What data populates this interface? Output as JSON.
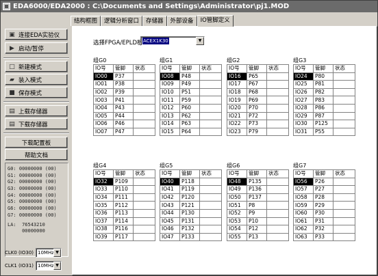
{
  "window": {
    "title": "EDA6000/EDA2000 : C:\\Documents and Settings\\Administrator\\pj1.MOD"
  },
  "sidebar": {
    "buttons": [
      {
        "label": "连接EDA实验仪",
        "icon": "connect-icon"
      },
      {
        "label": "启动/暂停",
        "icon": "play-icon"
      },
      {
        "label": "新建模式",
        "icon": "new-file-icon"
      },
      {
        "label": "装入模式",
        "icon": "open-folder-icon"
      },
      {
        "label": "保存模式",
        "icon": "save-disk-icon"
      },
      {
        "label": "上载存储器",
        "icon": "upload-memory-icon"
      },
      {
        "label": "下载存储器",
        "icon": "download-memory-icon"
      },
      {
        "label": "下载配置板"
      },
      {
        "label": "帮助文档"
      }
    ],
    "registers": [
      "G0: 00000000 (00)",
      "G1: 00000000 (00)",
      "G2: 00000000 (00)",
      "G3: 00000000 (00)",
      "G4: 00000000 (00)",
      "G5: 00000000 (00)",
      "G6: 00000000 (00)",
      "G7: 00000000 (00)"
    ],
    "la_line1": "LA:  76543210",
    "la_line2": "     00000000",
    "clk0": {
      "label": "CLK0 (IO30)",
      "value": "10MHz"
    },
    "clk1": {
      "label": "CLK1 (IO31)",
      "value": "10MHz"
    }
  },
  "tabs": [
    {
      "label": "结构框图",
      "active": false
    },
    {
      "label": "逻辑分析窗口",
      "active": false
    },
    {
      "label": "存储器",
      "active": false
    },
    {
      "label": "外部设备",
      "active": false
    },
    {
      "label": "IO管脚定义",
      "active": true
    }
  ],
  "main": {
    "fpga_label": "选择FPGA/EPLD板",
    "fpga_value": "ACEX1K30",
    "columns": [
      "IO号",
      "管脚",
      "状态"
    ],
    "groups": [
      {
        "label": "组G0",
        "rows": [
          [
            "IO00",
            "P37"
          ],
          [
            "IO01",
            "P38"
          ],
          [
            "IO02",
            "P39"
          ],
          [
            "IO03",
            "P41"
          ],
          [
            "IO04",
            "P43"
          ],
          [
            "IO05",
            "P44"
          ],
          [
            "IO06",
            "P46"
          ],
          [
            "IO07",
            "P47"
          ]
        ]
      },
      {
        "label": "组G1",
        "rows": [
          [
            "IO08",
            "P48"
          ],
          [
            "IO09",
            "P49"
          ],
          [
            "IO10",
            "P51"
          ],
          [
            "IO11",
            "P59"
          ],
          [
            "IO12",
            "P60"
          ],
          [
            "IO13",
            "P62"
          ],
          [
            "IO14",
            "P63"
          ],
          [
            "IO15",
            "P64"
          ]
        ]
      },
      {
        "label": "组G2",
        "rows": [
          [
            "IO16",
            "P65"
          ],
          [
            "IO17",
            "P67"
          ],
          [
            "IO18",
            "P68"
          ],
          [
            "IO19",
            "P69"
          ],
          [
            "IO20",
            "P70"
          ],
          [
            "IO21",
            "P72"
          ],
          [
            "IO22",
            "P73"
          ],
          [
            "IO23",
            "P79"
          ]
        ]
      },
      {
        "label": "组G3",
        "rows": [
          [
            "IO24",
            "P80"
          ],
          [
            "IO25",
            "P81"
          ],
          [
            "IO26",
            "P82"
          ],
          [
            "IO27",
            "P83"
          ],
          [
            "IO28",
            "P86"
          ],
          [
            "IO29",
            "P87"
          ],
          [
            "IO30",
            "P125"
          ],
          [
            "IO31",
            "P55"
          ]
        ]
      },
      {
        "label": "组G4",
        "rows": [
          [
            "IO32",
            "P109"
          ],
          [
            "IO33",
            "P110"
          ],
          [
            "IO34",
            "P111"
          ],
          [
            "IO35",
            "P112"
          ],
          [
            "IO36",
            "P113"
          ],
          [
            "IO37",
            "P114"
          ],
          [
            "IO38",
            "P116"
          ],
          [
            "IO39",
            "P117"
          ]
        ]
      },
      {
        "label": "组G5",
        "rows": [
          [
            "IO40",
            "P118"
          ],
          [
            "IO41",
            "P119"
          ],
          [
            "IO42",
            "P120"
          ],
          [
            "IO43",
            "P121"
          ],
          [
            "IO44",
            "P130"
          ],
          [
            "IO45",
            "P131"
          ],
          [
            "IO46",
            "P132"
          ],
          [
            "IO47",
            "P133"
          ]
        ]
      },
      {
        "label": "组G6",
        "rows": [
          [
            "IO48",
            "P135"
          ],
          [
            "IO49",
            "P136"
          ],
          [
            "IO50",
            "P137"
          ],
          [
            "IO51",
            "P8"
          ],
          [
            "IO52",
            "P9"
          ],
          [
            "IO53",
            "P10"
          ],
          [
            "IO54",
            "P12"
          ],
          [
            "IO55",
            "P13"
          ]
        ]
      },
      {
        "label": "组G7",
        "rows": [
          [
            "IO56",
            "P26"
          ],
          [
            "IO57",
            "P27"
          ],
          [
            "IO58",
            "P28"
          ],
          [
            "IO59",
            "P29"
          ],
          [
            "IO60",
            "P30"
          ],
          [
            "IO61",
            "P31"
          ],
          [
            "IO62",
            "P32"
          ],
          [
            "IO63",
            "P33"
          ]
        ]
      }
    ]
  }
}
